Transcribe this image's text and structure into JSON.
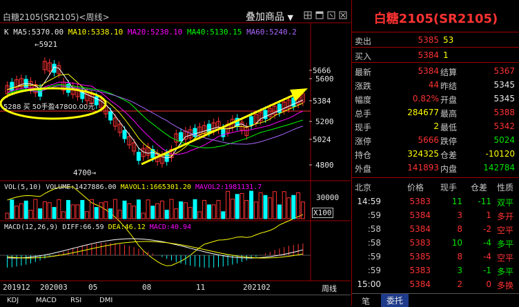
{
  "toolbar": {
    "title": "白糖2105(SR2105)",
    "period": "<周线>",
    "overlay_label": "叠加商品",
    "icons": [
      "tile-icon",
      "window-icon",
      "pin-icon",
      "close-icon"
    ]
  },
  "ma_legend": {
    "k": "K",
    "ma5": "MA5:5370.00",
    "ma10": "MA10:5338.10",
    "ma20": "MA20:5230.10",
    "ma40": "MA40:5130.15",
    "ma60": "MA60:5240.2"
  },
  "price_axis": [
    "5666",
    "5600",
    "5384",
    "5200",
    "5024",
    "4800"
  ],
  "price_marks": {
    "high": "5921",
    "low": "4700"
  },
  "annotation": {
    "text": "5288 买 50手盈47800.00元"
  },
  "volume": {
    "legend": "VOL(5,10) VOLUME:1427886.00",
    "mavol1": "MAVOL1:1665301.20",
    "mavol2": "MAVOL2:1981131.7",
    "axis_label": "30000",
    "unit": "X100"
  },
  "macd": {
    "label": "MACD(12,26,9)",
    "diff": "DIFF:66.59",
    "dea": "DEA:46.12",
    "macd": "MACD:40.94"
  },
  "date_axis": [
    "201912",
    "202003",
    "05",
    "08",
    "11",
    "202102",
    "周线"
  ],
  "bottom_tabs": [
    "KDJ",
    "MACD",
    "RSI",
    "DMI"
  ],
  "panel": {
    "title": "白糖2105(SR2105)",
    "sell": {
      "label": "卖出",
      "price": "5385",
      "vol": "53"
    },
    "buy": {
      "label": "买入",
      "price": "5384",
      "vol": "1"
    },
    "stats": [
      {
        "l1": "最新",
        "v1": "5384",
        "c1": "red",
        "l2": "结算",
        "v2": "5367",
        "c2": "red"
      },
      {
        "l1": "涨跌",
        "v1": "44",
        "c1": "red",
        "l2": "昨结",
        "v2": "5345",
        "c2": "white"
      },
      {
        "l1": "幅度",
        "v1": "0.82%",
        "c1": "red",
        "l2": "开盘",
        "v2": "5345",
        "c2": "white"
      },
      {
        "l1": "总手",
        "v1": "284677",
        "c1": "yellow",
        "l2": "最高",
        "v2": "5388",
        "c2": "red"
      },
      {
        "l1": "现手",
        "v1": "2",
        "c1": "yellow",
        "l2": "最低",
        "v2": "5342",
        "c2": "red"
      },
      {
        "l1": "涨停",
        "v1": "5666",
        "c1": "red",
        "l2": "跌停",
        "v2": "5024",
        "c2": "green"
      },
      {
        "l1": "持仓",
        "v1": "324325",
        "c1": "yellow",
        "l2": "仓差",
        "v2": "-10120",
        "c2": "yellow"
      },
      {
        "l1": "外盘",
        "v1": "141893",
        "c1": "red",
        "l2": "内盘",
        "v2": "142784",
        "c2": "green"
      }
    ],
    "tick_header": [
      "北京",
      "价格",
      "现手",
      "仓差",
      "性质"
    ],
    "ticks": [
      {
        "time": "14:59",
        "price": "5383",
        "pc": "red",
        "vol": "11",
        "vc": "green",
        "diff": "-11",
        "nature": "双平",
        "nc": "green"
      },
      {
        "time": ":59",
        "price": "5384",
        "pc": "red",
        "vol": "3",
        "vc": "red",
        "diff": "1",
        "nature": "多开",
        "nc": "red"
      },
      {
        "time": ":58",
        "price": "5384",
        "pc": "red",
        "vol": "8",
        "vc": "red",
        "diff": "-2",
        "nature": "空平",
        "nc": "red"
      },
      {
        "time": ":58",
        "price": "5383",
        "pc": "red",
        "vol": "10",
        "vc": "green",
        "diff": "-4",
        "nature": "多平",
        "nc": "green"
      },
      {
        "time": ":59",
        "price": "5385",
        "pc": "red",
        "vol": "8",
        "vc": "red",
        "diff": "-4",
        "nature": "空平",
        "nc": "red"
      },
      {
        "time": ":59",
        "price": "5383",
        "pc": "red",
        "vol": "3",
        "vc": "green",
        "diff": "-1",
        "nature": "多平",
        "nc": "green"
      },
      {
        "time": "15:00",
        "price": "5384",
        "pc": "red",
        "vol": "2",
        "vc": "red",
        "diff": "0",
        "nature": "多换",
        "nc": "red"
      }
    ],
    "bottom_tabs": [
      "笔",
      "委托"
    ]
  },
  "colors": {
    "up": "#ff3232",
    "down": "#00ffff",
    "ma5": "#ffffff",
    "ma10": "#ffff00",
    "ma20": "#ff00ff",
    "ma40": "#00ff00",
    "ma60": "#aa66ff",
    "arrow": "#ffff00",
    "border": "#a00000"
  }
}
